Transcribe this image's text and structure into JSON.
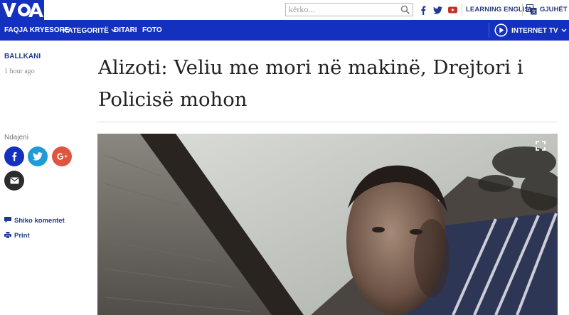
{
  "brand": {
    "logo_alt": "VOA",
    "color": "#1330bf"
  },
  "search": {
    "placeholder": "kërko...",
    "icon": "search-icon"
  },
  "social": [
    "facebook-icon",
    "twitter-icon",
    "youtube-icon"
  ],
  "top_links": {
    "learning_english": "LEARNING ENGLISH",
    "languages": "GJUHËT"
  },
  "nav": {
    "items": [
      {
        "label": "FAQJA KRYESORE"
      },
      {
        "label": "KATEGORITË"
      },
      {
        "label": "DITARI"
      },
      {
        "label": "FOTO"
      }
    ],
    "internet_tv": "INTERNET TV"
  },
  "article": {
    "section": "BALLKANI",
    "time": "1 hour ago",
    "headline": "Alizoti: Veliu me mori në makinë, Drejtori i Policisë mohon"
  },
  "share": {
    "label": "Ndajeni",
    "buttons": [
      {
        "icon": "facebook-icon",
        "color": "#1330bf"
      },
      {
        "icon": "twitter-icon",
        "color": "#1f9bd6"
      },
      {
        "icon": "google-plus-icon",
        "color": "#e0553f"
      },
      {
        "icon": "email-icon",
        "color": "#2c2c2c"
      }
    ]
  },
  "side_links": {
    "comments": "Shiko komentet",
    "print": "Print"
  },
  "colors": {
    "nav_bg": "#1330bf",
    "link": "#1e3a8c"
  }
}
